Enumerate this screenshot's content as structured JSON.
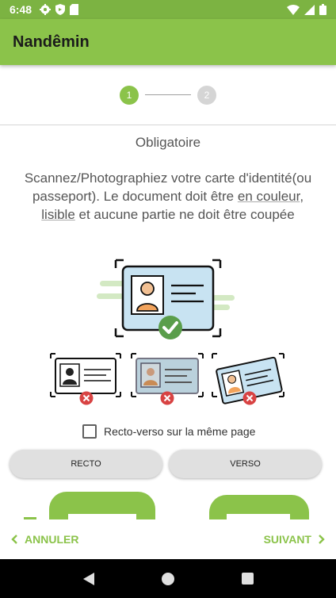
{
  "status_bar": {
    "time": "6:48"
  },
  "app_bar": {
    "title": "Nandêmin"
  },
  "stepper": {
    "steps": [
      "1",
      "2"
    ],
    "current_step": 1
  },
  "content": {
    "required_label": "Obligatoire",
    "instructions": {
      "part1": "Scannez/Photographiez votre carte d'identité(ou passeport). Le document doit être ",
      "emph1": "en couleur",
      "sep": ", ",
      "emph2": "lisible",
      "part2": " et aucune partie ne doit être coupée"
    },
    "checkbox": {
      "label": "Recto-verso sur la même page",
      "checked": false
    },
    "buttons": {
      "recto": "RECTO",
      "verso": "VERSO"
    }
  },
  "bottom_nav": {
    "cancel": "ANNULER",
    "next": "SUIVANT"
  },
  "colors": {
    "accent": "#8bc34a",
    "status_bar": "#7cb342",
    "error": "#d84343",
    "success": "#5a9e4b"
  }
}
